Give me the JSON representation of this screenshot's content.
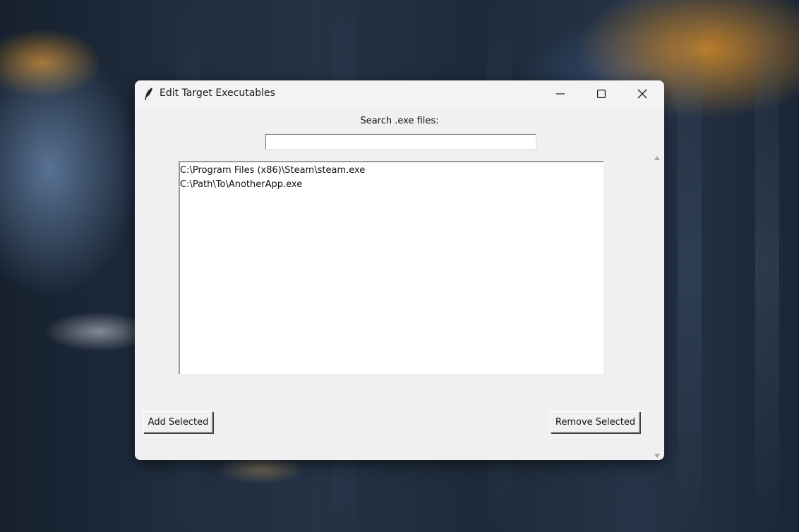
{
  "window": {
    "title": "Edit Target Executables",
    "controls": {
      "minimize_icon": "minimize-icon",
      "maximize_icon": "maximize-icon",
      "close_icon": "close-icon"
    }
  },
  "search": {
    "label": "Search .exe files:",
    "value": "",
    "placeholder": ""
  },
  "executables": {
    "items": [
      "C:\\Program Files (x86)\\Steam\\steam.exe",
      "C:\\Path\\To\\AnotherApp.exe"
    ]
  },
  "actions": {
    "add_label": "Add Selected",
    "remove_label": "Remove Selected"
  },
  "scrollbar": {
    "up_icon": "scroll-up-arrow-icon",
    "down_icon": "scroll-down-arrow-icon"
  },
  "colors": {
    "window_bg": "#f0f0f0",
    "list_bg": "#ffffff",
    "text": "#111111"
  }
}
